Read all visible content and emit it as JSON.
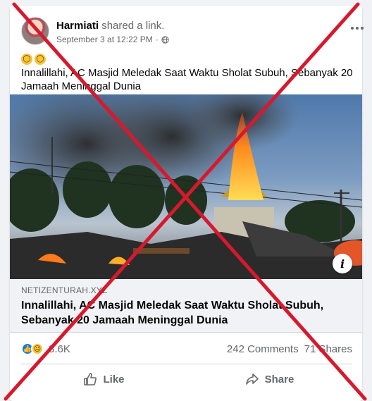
{
  "post": {
    "author": "Harmiati",
    "action": " shared a link.",
    "timestamp": "September 3 at 12:22 PM",
    "separator": "·",
    "text": "Innalillahi, AC Masjid Meledak Saat Waktu Sholat Subuh, Sebanyak 20 Jamaah Meninggal Dunia"
  },
  "link": {
    "domain": "NETIZENTURAH.XYZ",
    "title": "Innalillahi, AC Masjid Meledak Saat Waktu Sholat Subuh, Sebanyak 20 Jamaah Meninggal Dunia",
    "info_glyph": "i"
  },
  "reactions": {
    "count": "3.6K",
    "comments": "242 Comments",
    "shares": "71 Shares"
  },
  "actions": {
    "like_label": "Like",
    "share_label": "Share"
  },
  "icons": {
    "emojis": [
      "scream-emoji-icon",
      "scream-emoji-icon"
    ],
    "privacy": "globe-icon",
    "more": "more-dots-icon",
    "like": "thumbs-up-icon",
    "share": "share-arrow-icon"
  },
  "colors": {
    "overlay_x": "#d7192d",
    "like_blue": "#1877f2",
    "card_bg": "#ffffff",
    "page_bg": "#f0f2f5"
  }
}
